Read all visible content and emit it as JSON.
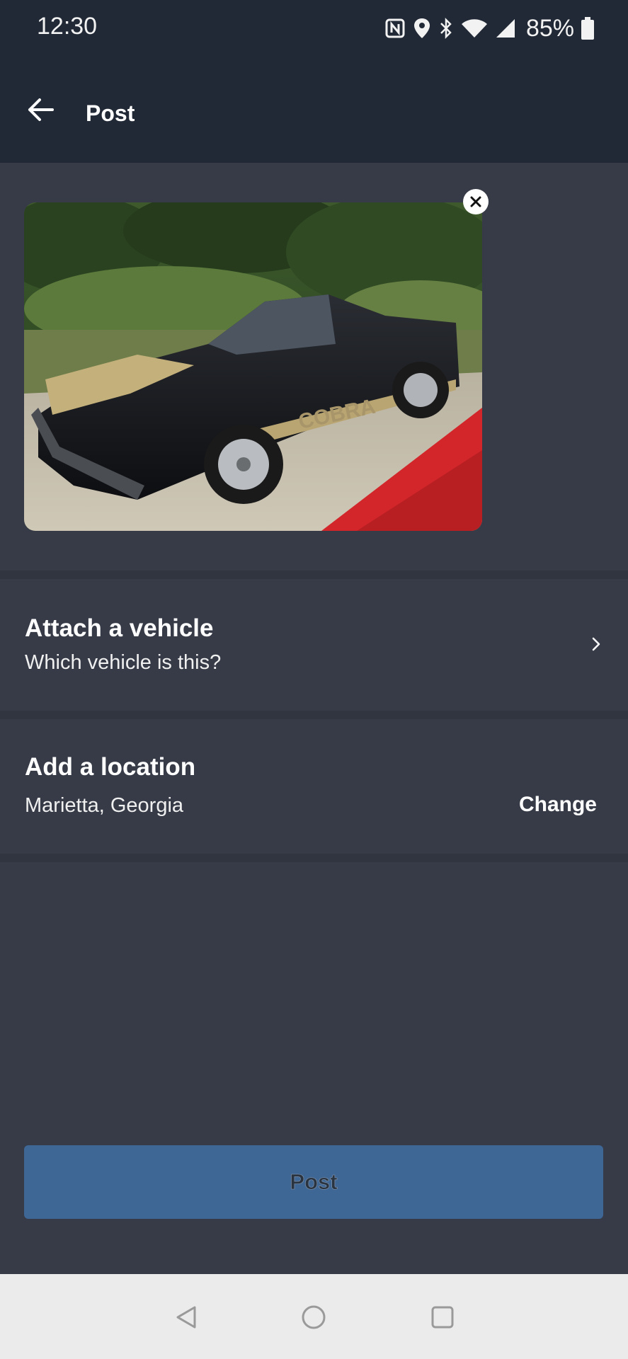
{
  "status_bar": {
    "time": "12:30",
    "battery": "85%",
    "icons": [
      "nfc-icon",
      "location-icon",
      "bluetooth-icon",
      "wifi-icon",
      "signal-icon",
      "battery-icon"
    ]
  },
  "app_bar": {
    "title": "Post",
    "back_icon": "arrow-left-icon"
  },
  "photo": {
    "remove_icon": "close-icon",
    "car_lettering": "COBRA"
  },
  "vehicle": {
    "title": "Attach a vehicle",
    "subtitle": "Which vehicle is this?",
    "icon": "chevron-right-icon"
  },
  "location": {
    "title": "Add a location",
    "value": "Marietta, Georgia",
    "change_label": "Change"
  },
  "post_button": {
    "label": "Post"
  },
  "nav": {
    "back_icon": "triangle-back-icon",
    "home_icon": "circle-home-icon",
    "recents_icon": "square-recents-icon"
  },
  "colors": {
    "header_bg": "#212936",
    "content_bg": "#363b47",
    "button_bg": "#3e6796",
    "nav_bg": "#ebebeb"
  }
}
